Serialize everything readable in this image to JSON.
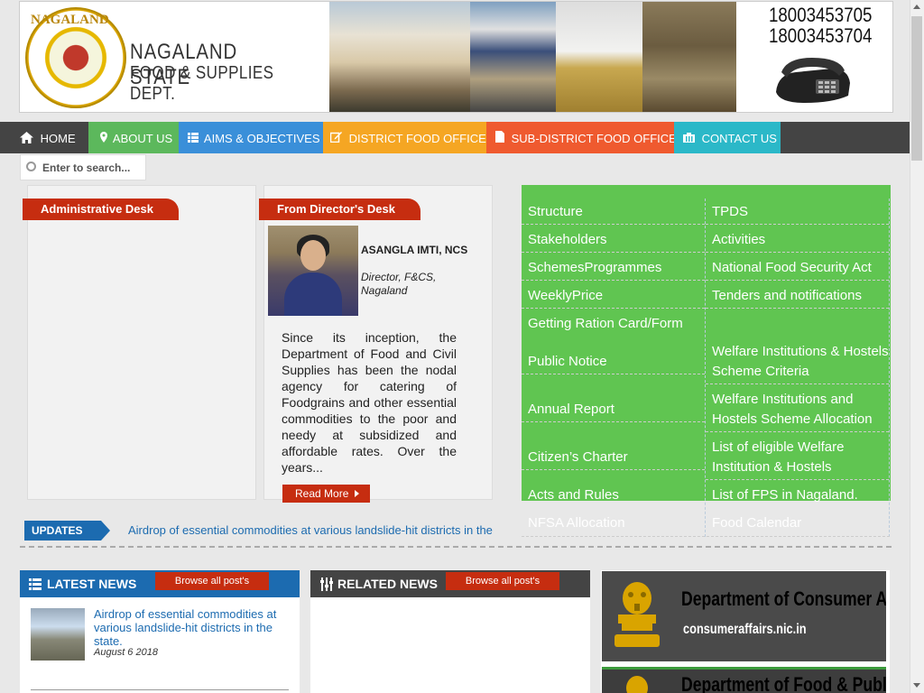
{
  "header": {
    "logo_arc_text": "NAGALAND",
    "logo_title": "NAGALAND STATE",
    "logo_subtitle": "FOOD & SUPPLIES DEPT.",
    "phone_1": "18003453705",
    "phone_2": "18003453704"
  },
  "nav": {
    "items": [
      {
        "label": "HOME",
        "icon": "home-icon",
        "color": "#444444"
      },
      {
        "label": "ABOUT US",
        "icon": "map-marker-icon",
        "color": "#5cb85c"
      },
      {
        "label": "AIMS & OBJECTIVES",
        "icon": "list-icon",
        "color": "#3a8fd9"
      },
      {
        "label": "DISTRICT FOOD OFFICE",
        "icon": "edit-icon",
        "color": "#f5a623"
      },
      {
        "label": "SUB-DISTRICT FOOD OFFICE",
        "icon": "file-icon",
        "color": "#ef5a2f"
      },
      {
        "label": "CONTACT US",
        "icon": "building-icon",
        "color": "#2bb8c8"
      }
    ]
  },
  "search": {
    "placeholder": "Enter to search..."
  },
  "admin_desk": {
    "title": "Administrative Desk"
  },
  "director_desk": {
    "title": "From Director's Desk",
    "name": "ASANGLA IMTI, NCS",
    "designation": "Director, F&CS, Nagaland",
    "text": "Since its inception, the Department of Food and Civil Supplies has been the nodal agency for catering of Foodgrains and other essential commodities to the poor and needy at subsidized and affordable rates. Over the years...",
    "read_more": "Read More"
  },
  "quick_links": {
    "left": [
      "Structure",
      "Stakeholders",
      "SchemesProgrammes",
      "WeeklyPrice",
      "Getting Ration Card/Form",
      "Public Notice",
      "Annual Report",
      "Citizen’s Charter",
      "Acts and Rules",
      "NFSA Allocation"
    ],
    "right": [
      "TPDS",
      "Activities",
      "National Food Security Act",
      "Tenders and notifications",
      "Welfare Institutions & Hostels Scheme Criteria",
      "Welfare Institutions and Hostels Scheme Allocation",
      "List of eligible Welfare Institution & Hostels",
      "List of FPS in Nagaland.",
      "Food Calendar"
    ]
  },
  "updates": {
    "label": "UPDATES",
    "ticker": "Airdrop of essential commodities at various landslide-hit districts in the"
  },
  "latest_news": {
    "title": "LATEST NEWS",
    "browse": "Browse all post's",
    "item_title": "Airdrop of essential commodities at various landslide-hit districts in the state.",
    "item_date": "August 6 2018"
  },
  "related_news": {
    "title": "RELATED NEWS",
    "browse": "Browse all post's"
  },
  "ads": [
    {
      "title": "Department of Consumer Affairs",
      "subtitle": "consumeraffairs.nic.in"
    },
    {
      "title": "Department of Food & Public Distribution"
    }
  ]
}
